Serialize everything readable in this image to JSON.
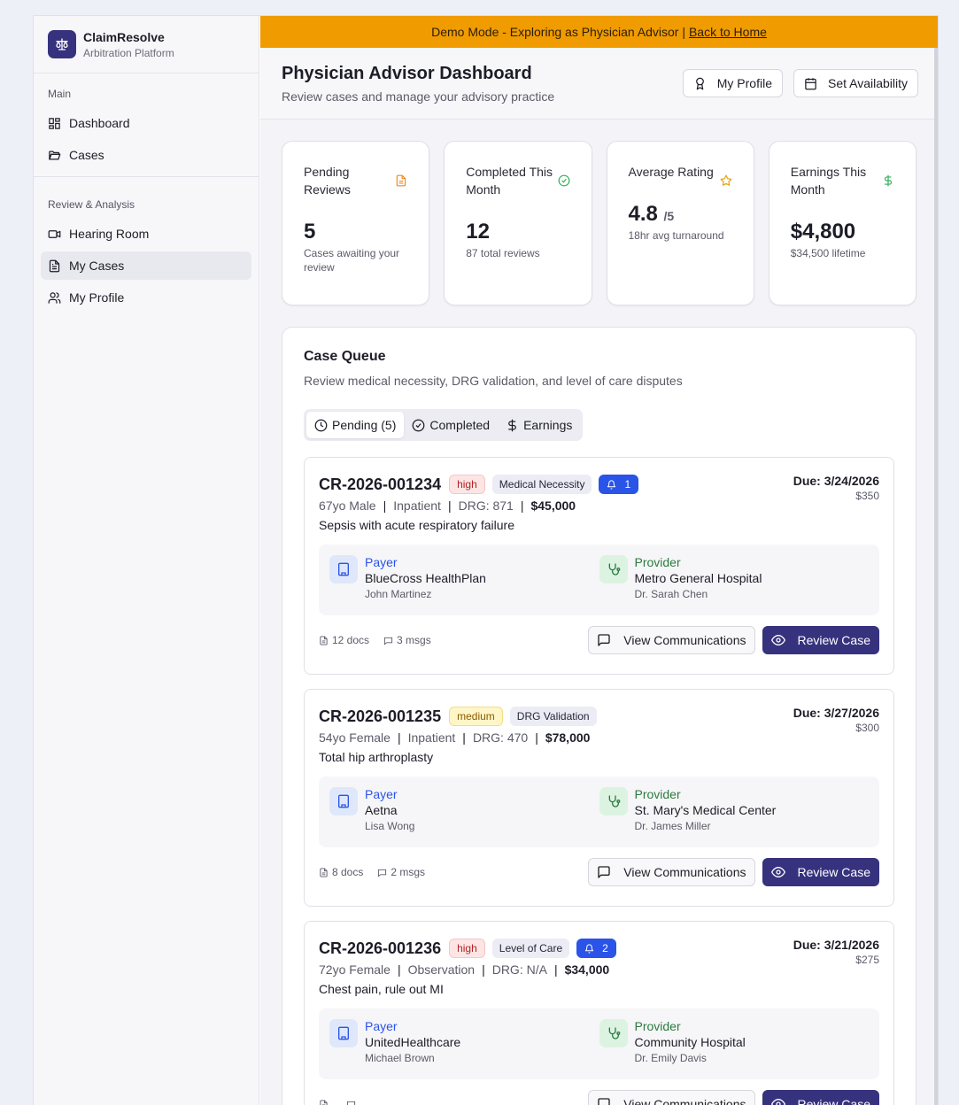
{
  "brand": {
    "title": "ClaimResolve",
    "subtitle": "Arbitration Platform"
  },
  "sidebar": {
    "sections": [
      {
        "heading": "Main",
        "items": [
          {
            "label": "Dashboard",
            "icon": "dashboard-icon"
          },
          {
            "label": "Cases",
            "icon": "folder-open-icon"
          }
        ]
      },
      {
        "heading": "Review & Analysis",
        "items": [
          {
            "label": "Hearing Room",
            "icon": "video-icon"
          },
          {
            "label": "My Cases",
            "icon": "file-text-icon",
            "active": true
          },
          {
            "label": "My Profile",
            "icon": "users-icon"
          }
        ]
      }
    ]
  },
  "banner": {
    "text": "Demo Mode - Exploring as Physician Advisor |",
    "link": "Back to Home"
  },
  "header": {
    "title": "Physician Advisor Dashboard",
    "subtitle": "Review cases and manage your advisory practice",
    "profile_button": "My Profile",
    "availability_button": "Set Availability"
  },
  "stats": [
    {
      "label": "Pending Reviews",
      "value": "5",
      "suffix": "",
      "sub": "Cases awaiting your review",
      "icon": "file-icon",
      "color": "#f08a1c"
    },
    {
      "label": "Completed This Month",
      "value": "12",
      "suffix": "",
      "sub": "87 total reviews",
      "icon": "check-circle-icon",
      "color": "#2fae5a"
    },
    {
      "label": "Average Rating",
      "value": "4.8",
      "suffix": "/5",
      "sub": "18hr avg turnaround",
      "icon": "star-icon",
      "color": "#e3a008"
    },
    {
      "label": "Earnings This Month",
      "value": "$4,800",
      "suffix": "",
      "sub": "$34,500 lifetime",
      "icon": "dollar-icon",
      "color": "#2fae5a"
    }
  ],
  "queue": {
    "title": "Case Queue",
    "subtitle": "Review medical necessity, DRG validation, and level of care disputes",
    "tabs": [
      {
        "label": "Pending (5)",
        "icon": "clock-icon",
        "active": true
      },
      {
        "label": "Completed",
        "icon": "check-circle-icon"
      },
      {
        "label": "Earnings",
        "icon": "dollar-icon"
      }
    ]
  },
  "cases": [
    {
      "id": "CR-2026-001234",
      "priority": "high",
      "type": "Medical Necessity",
      "alerts": "1",
      "due": "Due: 3/24/2026",
      "fee": "$350",
      "patient": "67yo Male",
      "setting": "Inpatient",
      "drg": "DRG: 871",
      "amount": "$45,000",
      "diagnosis": "Sepsis with acute respiratory failure",
      "payer_label": "Payer",
      "payer": "BlueCross HealthPlan",
      "payer_contact": "John Martinez",
      "provider_label": "Provider",
      "provider": "Metro General Hospital",
      "provider_contact": "Dr. Sarah Chen",
      "docs": "12 docs",
      "msgs": "3 msgs",
      "comm_button": "View Communications",
      "review_button": "Review Case"
    },
    {
      "id": "CR-2026-001235",
      "priority": "medium",
      "type": "DRG Validation",
      "alerts": "",
      "due": "Due: 3/27/2026",
      "fee": "$300",
      "patient": "54yo Female",
      "setting": "Inpatient",
      "drg": "DRG: 470",
      "amount": "$78,000",
      "diagnosis": "Total hip arthroplasty",
      "payer_label": "Payer",
      "payer": "Aetna",
      "payer_contact": "Lisa Wong",
      "provider_label": "Provider",
      "provider": "St. Mary's Medical Center",
      "provider_contact": "Dr. James Miller",
      "docs": "8 docs",
      "msgs": "2 msgs",
      "comm_button": "View Communications",
      "review_button": "Review Case"
    },
    {
      "id": "CR-2026-001236",
      "priority": "high",
      "type": "Level of Care",
      "alerts": "2",
      "due": "Due: 3/21/2026",
      "fee": "$275",
      "patient": "72yo Female",
      "setting": "Observation",
      "drg": "DRG: N/A",
      "amount": "$34,000",
      "diagnosis": "Chest pain, rule out MI",
      "payer_label": "Payer",
      "payer": "UnitedHealthcare",
      "payer_contact": "Michael Brown",
      "provider_label": "Provider",
      "provider": "Community Hospital",
      "provider_contact": "Dr. Emily Davis",
      "docs": "",
      "msgs": "",
      "comm_button": "View Communications",
      "review_button": "Review Case"
    }
  ]
}
